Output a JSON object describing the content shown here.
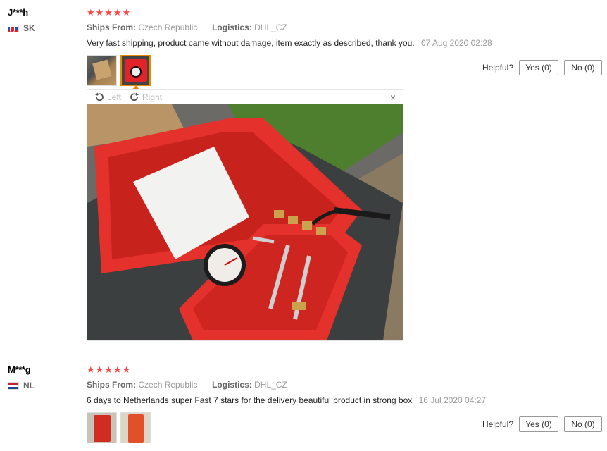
{
  "reviews": [
    {
      "user": "J***h",
      "country": "SK",
      "ships_from_label": "Ships From:",
      "ships_from": "Czech Republic",
      "logistics_label": "Logistics:",
      "logistics": "DHL_CZ",
      "text": "Very fast shipping, product came without damage, item exactly as described, thank you.",
      "date": "07 Aug 2020 02:28",
      "helpful_label": "Helpful?",
      "yes": "Yes (0)",
      "no": "No (0)",
      "viewer": {
        "left": "Left",
        "right": "Right",
        "close": "×"
      }
    },
    {
      "user": "M***g",
      "country": "NL",
      "ships_from_label": "Ships From:",
      "ships_from": "Czech Republic",
      "logistics_label": "Logistics:",
      "logistics": "DHL_CZ",
      "text": "6 days to Netherlands super Fast 7 stars for the delivery beautiful product in strong box",
      "date": "16 Jul 2020 04:27",
      "helpful_label": "Helpful?",
      "yes": "Yes (0)",
      "no": "No (0)"
    }
  ],
  "star_glyph": "★",
  "colors": {
    "star": "#ff4444",
    "active_thumb": "#e68a00"
  }
}
